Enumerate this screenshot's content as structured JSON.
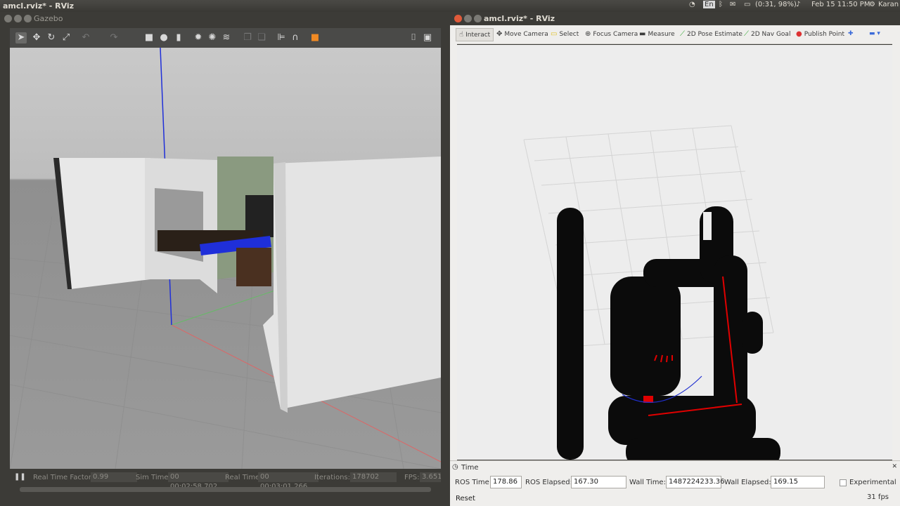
{
  "system": {
    "window_title": "amcl.rviz* - RViz",
    "keyboard": "En",
    "battery": "(0:31, 98%)",
    "datetime": "Feb 15 11:50 PM",
    "user": "Karan"
  },
  "gazebo": {
    "window_title": "Gazebo",
    "status": {
      "rtf_label": "Real Time Factor:",
      "rtf_value": "0.99",
      "sim_label": "Sim Time:",
      "sim_value": "00 00:02:58.702",
      "real_label": "Real Time:",
      "real_value": "00 00:03:01.266",
      "iter_label": "Iterations:",
      "iter_value": "178702",
      "fps_label": "FPS:",
      "fps_value": "3.651"
    }
  },
  "rviz": {
    "window_title": "amcl.rviz* - RViz",
    "tools": {
      "interact": "Interact",
      "move_camera": "Move Camera",
      "select": "Select",
      "focus_camera": "Focus Camera",
      "measure": "Measure",
      "pose_estimate": "2D Pose Estimate",
      "nav_goal": "2D Nav Goal",
      "publish_point": "Publish Point"
    },
    "time_panel": {
      "title": "Time",
      "ros_time_label": "ROS Time:",
      "ros_time": "178.86",
      "ros_elapsed_label": "ROS Elapsed:",
      "ros_elapsed": "167.30",
      "wall_time_label": "Wall Time:",
      "wall_time": "1487224233.36",
      "wall_elapsed_label": "Wall Elapsed:",
      "wall_elapsed": "169.15",
      "experimental_label": "Experimental",
      "reset_label": "Reset",
      "fps": "31 fps"
    }
  },
  "colors": {
    "costmap": "#0b0b0b",
    "laser": "#e00000",
    "path": "#2030d0",
    "z_axis": "#1f2fd9"
  }
}
